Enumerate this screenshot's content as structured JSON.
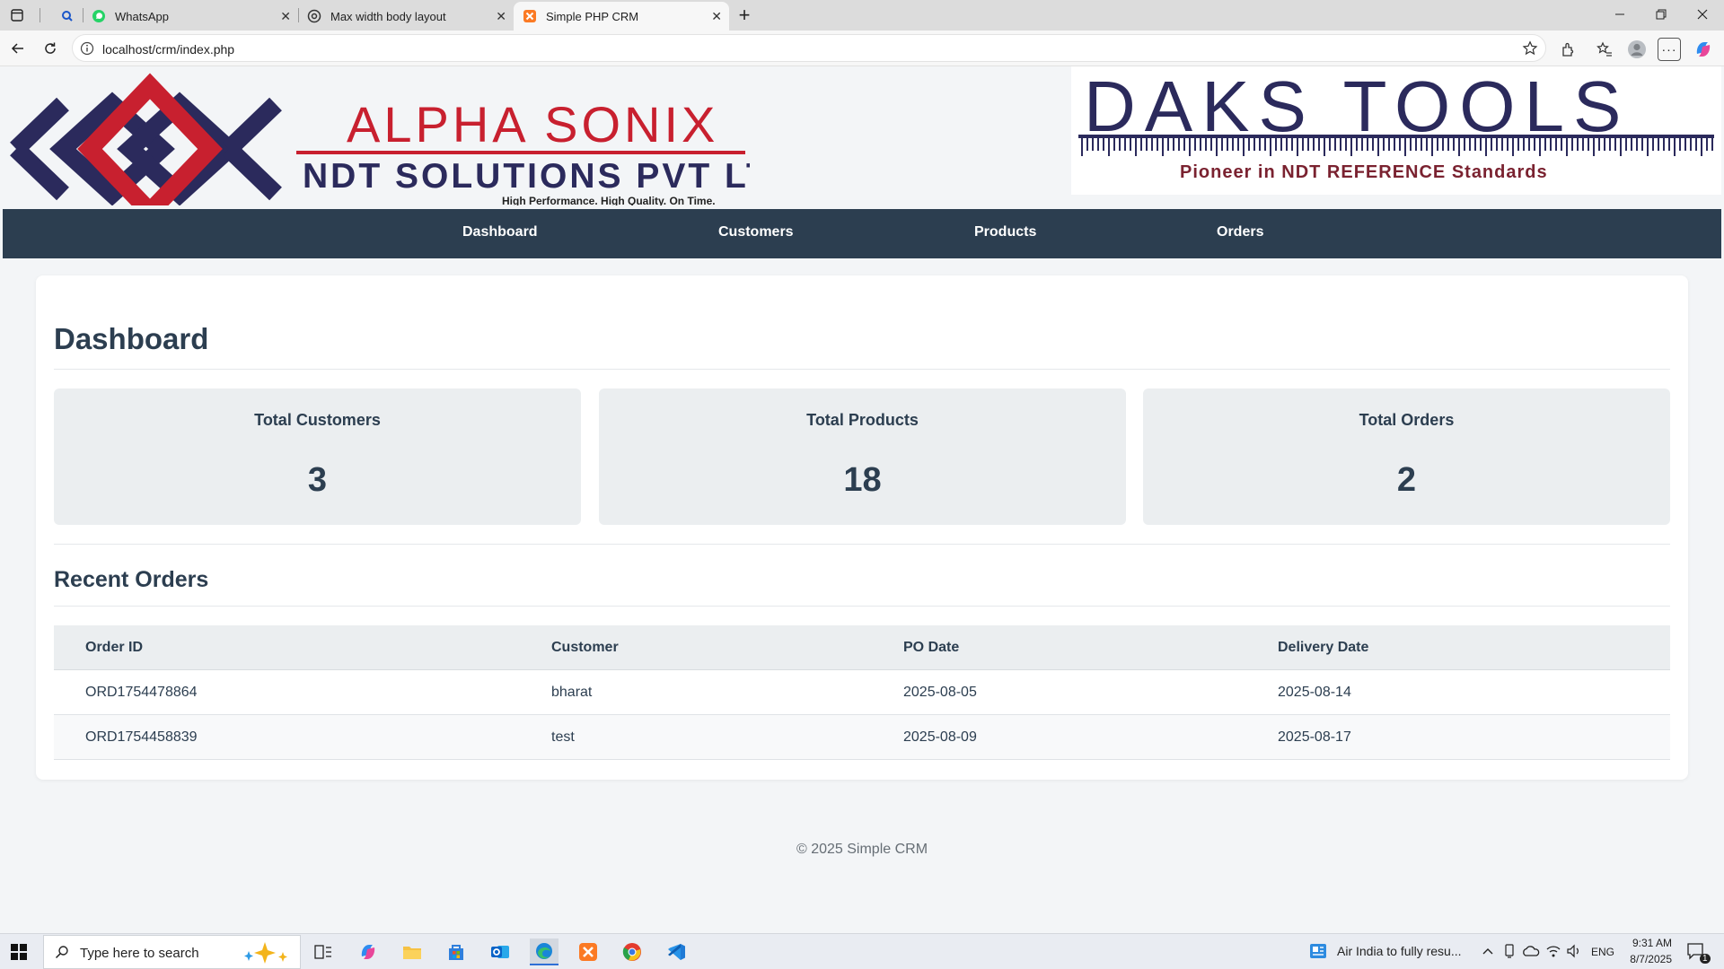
{
  "browser": {
    "tabs": [
      {
        "title": "",
        "icon": "search-icon"
      },
      {
        "title": "WhatsApp",
        "icon": "whatsapp-icon"
      },
      {
        "title": "Max width body layout",
        "icon": "chatgpt-icon"
      },
      {
        "title": "Simple PHP CRM",
        "icon": "xampp-icon",
        "active": true
      }
    ],
    "url": "localhost/crm/index.php"
  },
  "header": {
    "left_logo": {
      "line1": "ALPHA SONIX",
      "line2": "NDT SOLUTIONS PVT LTD",
      "tagline": "High Performance. High Quality. On Time.",
      "colors": {
        "red": "#c8202f",
        "navy": "#2b2a5c"
      }
    },
    "right_logo": {
      "name": "DAKS TOOLS",
      "tagline": "Pioneer in NDT REFERENCE Standards",
      "colors": {
        "navy": "#2b2a5c",
        "maroon": "#7a2230"
      }
    }
  },
  "nav": {
    "items": [
      "Dashboard",
      "Customers",
      "Products",
      "Orders"
    ],
    "background": "#2c3e50"
  },
  "dashboard": {
    "title": "Dashboard",
    "stats": [
      {
        "label": "Total Customers",
        "value": "3"
      },
      {
        "label": "Total Products",
        "value": "18"
      },
      {
        "label": "Total Orders",
        "value": "2"
      }
    ],
    "recent_orders": {
      "title": "Recent Orders",
      "columns": [
        "Order ID",
        "Customer",
        "PO Date",
        "Delivery Date"
      ],
      "rows": [
        [
          "ORD1754478864",
          "bharat",
          "2025-08-05",
          "2025-08-14"
        ],
        [
          "ORD1754458839",
          "test",
          "2025-08-09",
          "2025-08-17"
        ]
      ]
    }
  },
  "footer": {
    "text": "© 2025 Simple CRM"
  },
  "taskbar": {
    "search_placeholder": "Type here to search",
    "news": "Air India to fully resu...",
    "language": "ENG",
    "time": "9:31 AM",
    "date": "8/7/2025",
    "notification_count": "1"
  }
}
